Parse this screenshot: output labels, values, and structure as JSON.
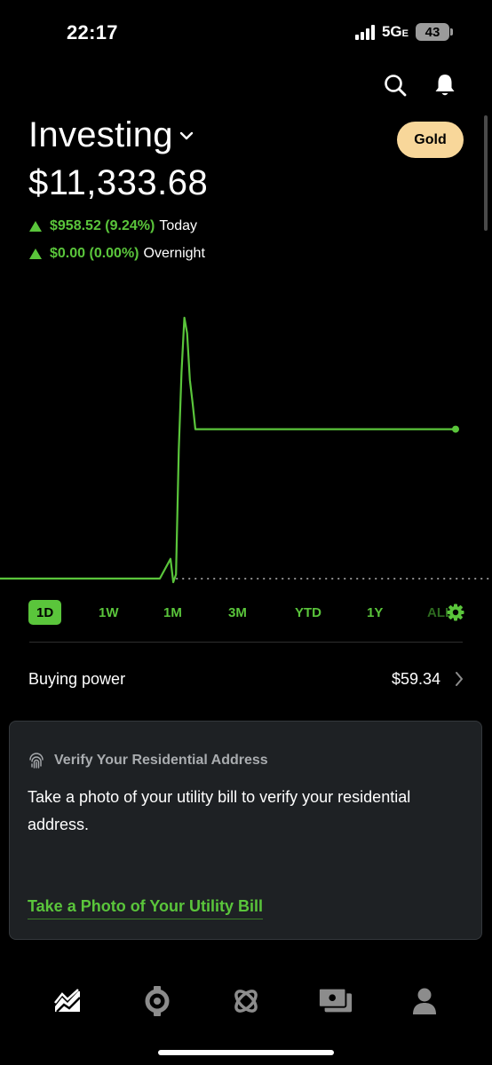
{
  "status_bar": {
    "time": "22:17",
    "network": "5G",
    "network_suffix": "E",
    "battery": "43"
  },
  "header": {
    "title": "Investing",
    "gold_label": "Gold",
    "search_icon": "search-icon",
    "bell_icon": "bell-icon"
  },
  "portfolio": {
    "value": "$11,333.68",
    "today": {
      "amount": "$958.52 (9.24%)",
      "label": "Today"
    },
    "overnight": {
      "amount": "$0.00 (0.00%)",
      "label": "Overnight"
    }
  },
  "chart_data": {
    "type": "line",
    "series": [
      {
        "values": [
          10373.16,
          10373.16,
          10373.16,
          10373.16,
          10373.16,
          10373.16,
          10373.16,
          10373.16,
          10373.16,
          10373.16,
          10373.16,
          10373.16,
          10373.16,
          10373.16,
          10373.16,
          10373.16,
          10500,
          10350,
          10400,
          11200,
          11700,
          12050,
          11950,
          11650,
          11500,
          11333.68,
          11333.68,
          11333.68,
          11333.68,
          11333.68,
          11333.68,
          11333.68,
          11333.68,
          11333.68,
          11333.68,
          11333.68
        ]
      }
    ],
    "reference_line": 10373.16,
    "color": "#5ac53b",
    "grid": false
  },
  "range_tabs": [
    "1D",
    "1W",
    "1M",
    "3M",
    "YTD",
    "1Y",
    "ALL"
  ],
  "range_selected": "1D",
  "buying_power": {
    "label": "Buying power",
    "value": "$59.34"
  },
  "card": {
    "title": "Verify Your Residential Address",
    "body": "Take a photo of your utility bill to verify your residential address.",
    "link": "Take a Photo of Your Utility Bill"
  },
  "bottom_nav": [
    "investing-chart-icon",
    "crypto-icon",
    "retirement-icon",
    "cash-icon",
    "account-icon"
  ],
  "colors": {
    "accent": "#5ac53b",
    "gold": "#f8d79a",
    "card_bg": "#1e2124"
  }
}
